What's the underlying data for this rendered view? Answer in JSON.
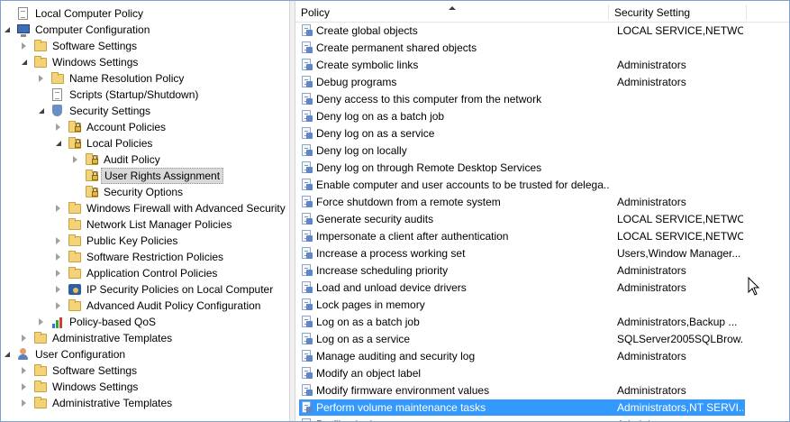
{
  "tree": [
    {
      "label": "Local Computer Policy",
      "depth": 0,
      "twisty": "none",
      "icon": "doc",
      "name": "local-computer-policy"
    },
    {
      "label": "Computer Configuration",
      "depth": 0,
      "twisty": "expanded",
      "icon": "monitor",
      "name": "computer-configuration"
    },
    {
      "label": "Software Settings",
      "depth": 1,
      "twisty": "collapsed",
      "icon": "folder",
      "name": "software-settings"
    },
    {
      "label": "Windows Settings",
      "depth": 1,
      "twisty": "expanded",
      "icon": "folder",
      "name": "windows-settings"
    },
    {
      "label": "Name Resolution Policy",
      "depth": 2,
      "twisty": "collapsed",
      "icon": "folder",
      "name": "name-resolution-policy"
    },
    {
      "label": "Scripts (Startup/Shutdown)",
      "depth": 2,
      "twisty": "none",
      "icon": "doc",
      "name": "scripts-startup-shutdown"
    },
    {
      "label": "Security Settings",
      "depth": 2,
      "twisty": "expanded",
      "icon": "shield",
      "name": "security-settings"
    },
    {
      "label": "Account Policies",
      "depth": 3,
      "twisty": "collapsed",
      "icon": "folderlock",
      "name": "account-policies"
    },
    {
      "label": "Local Policies",
      "depth": 3,
      "twisty": "expanded",
      "icon": "folderlock",
      "name": "local-policies"
    },
    {
      "label": "Audit Policy",
      "depth": 4,
      "twisty": "collapsed",
      "icon": "folderlock",
      "name": "audit-policy"
    },
    {
      "label": "User Rights Assignment",
      "depth": 4,
      "twisty": "none",
      "icon": "folderlock",
      "selected": true,
      "name": "user-rights-assignment"
    },
    {
      "label": "Security Options",
      "depth": 4,
      "twisty": "none",
      "icon": "folderlock",
      "name": "security-options"
    },
    {
      "label": "Windows Firewall with Advanced Security",
      "depth": 3,
      "twisty": "collapsed",
      "icon": "folder",
      "name": "windows-firewall"
    },
    {
      "label": "Network List Manager Policies",
      "depth": 3,
      "twisty": "none",
      "icon": "folder",
      "name": "network-list-manager-policies"
    },
    {
      "label": "Public Key Policies",
      "depth": 3,
      "twisty": "collapsed",
      "icon": "folder",
      "name": "public-key-policies"
    },
    {
      "label": "Software Restriction Policies",
      "depth": 3,
      "twisty": "collapsed",
      "icon": "folder",
      "name": "software-restriction-policies"
    },
    {
      "label": "Application Control Policies",
      "depth": 3,
      "twisty": "collapsed",
      "icon": "folder",
      "name": "application-control-policies"
    },
    {
      "label": "IP Security Policies on Local Computer",
      "depth": 3,
      "twisty": "collapsed",
      "icon": "net",
      "name": "ip-security-policies"
    },
    {
      "label": "Advanced Audit Policy Configuration",
      "depth": 3,
      "twisty": "collapsed",
      "icon": "folder",
      "name": "advanced-audit-policy-configuration"
    },
    {
      "label": "Policy-based QoS",
      "depth": 2,
      "twisty": "collapsed",
      "icon": "bars",
      "name": "policy-based-qos"
    },
    {
      "label": "Administrative Templates",
      "depth": 1,
      "twisty": "collapsed",
      "icon": "folder",
      "name": "computer-administrative-templates"
    },
    {
      "label": "User Configuration",
      "depth": 0,
      "twisty": "expanded",
      "icon": "user",
      "name": "user-configuration"
    },
    {
      "label": "Software Settings",
      "depth": 1,
      "twisty": "collapsed",
      "icon": "folder",
      "name": "user-software-settings"
    },
    {
      "label": "Windows Settings",
      "depth": 1,
      "twisty": "collapsed",
      "icon": "folder",
      "name": "user-windows-settings"
    },
    {
      "label": "Administrative Templates",
      "depth": 1,
      "twisty": "collapsed",
      "icon": "folder",
      "name": "user-administrative-templates"
    }
  ],
  "list": {
    "columns": {
      "policy": "Policy",
      "setting": "Security Setting"
    },
    "sort": "ascending",
    "rows": [
      {
        "policy": "Create global objects",
        "setting": "LOCAL SERVICE,NETWO..."
      },
      {
        "policy": "Create permanent shared objects",
        "setting": ""
      },
      {
        "policy": "Create symbolic links",
        "setting": "Administrators"
      },
      {
        "policy": "Debug programs",
        "setting": "Administrators"
      },
      {
        "policy": "Deny access to this computer from the network",
        "setting": ""
      },
      {
        "policy": "Deny log on as a batch job",
        "setting": ""
      },
      {
        "policy": "Deny log on as a service",
        "setting": ""
      },
      {
        "policy": "Deny log on locally",
        "setting": ""
      },
      {
        "policy": "Deny log on through Remote Desktop Services",
        "setting": ""
      },
      {
        "policy": "Enable computer and user accounts to be trusted for delega...",
        "setting": ""
      },
      {
        "policy": "Force shutdown from a remote system",
        "setting": "Administrators"
      },
      {
        "policy": "Generate security audits",
        "setting": "LOCAL SERVICE,NETWO..."
      },
      {
        "policy": "Impersonate a client after authentication",
        "setting": "LOCAL SERVICE,NETWO..."
      },
      {
        "policy": "Increase a process working set",
        "setting": "Users,Window Manager..."
      },
      {
        "policy": "Increase scheduling priority",
        "setting": "Administrators"
      },
      {
        "policy": "Load and unload device drivers",
        "setting": "Administrators"
      },
      {
        "policy": "Lock pages in memory",
        "setting": ""
      },
      {
        "policy": "Log on as a batch job",
        "setting": "Administrators,Backup ..."
      },
      {
        "policy": "Log on as a service",
        "setting": "SQLServer2005SQLBrow..."
      },
      {
        "policy": "Manage auditing and security log",
        "setting": "Administrators"
      },
      {
        "policy": "Modify an object label",
        "setting": ""
      },
      {
        "policy": "Modify firmware environment values",
        "setting": "Administrators"
      },
      {
        "policy": "Perform volume maintenance tasks",
        "setting": "Administrators,NT SERVI...",
        "selected": true
      },
      {
        "policy": "Profile single process",
        "setting": "Administrators"
      }
    ]
  },
  "colors": {
    "selection": "#3399ff",
    "tree_selection": "#d9d9d9",
    "border": "#7da2ce"
  }
}
